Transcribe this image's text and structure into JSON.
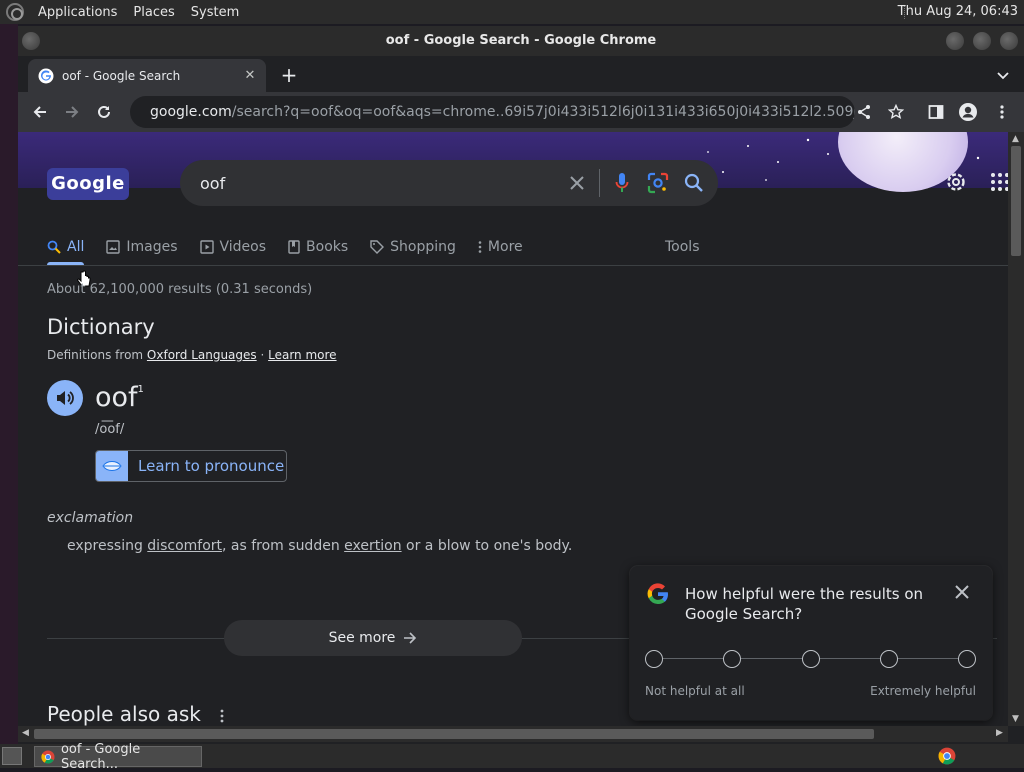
{
  "os": {
    "menus": [
      "Applications",
      "Places",
      "System"
    ],
    "clock": "Thu Aug 24, 06:43"
  },
  "window": {
    "title": "oof - Google Search - Google Chrome"
  },
  "browser": {
    "tab_title": "oof - Google Search",
    "url_host": "google.com",
    "url_rest": "/search?q=oof&oq=oof&aqs=chrome..69i57j0i433i512l6j0i131i433i650j0i433i512l2.509j0j7&sou…"
  },
  "google": {
    "logo_text": "Google",
    "query": "oof",
    "tabs": [
      {
        "label": "All",
        "icon": "search-icon",
        "active": true
      },
      {
        "label": "Images",
        "icon": "image-icon"
      },
      {
        "label": "Videos",
        "icon": "video-icon"
      },
      {
        "label": "Books",
        "icon": "book-icon"
      },
      {
        "label": "Shopping",
        "icon": "tag-icon"
      },
      {
        "label": "More",
        "icon": "more-vert-icon"
      }
    ],
    "tools_label": "Tools",
    "result_stats": "About 62,100,000 results (0.31 seconds)"
  },
  "dictionary": {
    "title": "Dictionary",
    "source_prefix": "Definitions from ",
    "source_link": "Oxford Languages",
    "source_sep": " · ",
    "learn_more": "Learn more",
    "word": "oof",
    "superscript": "1",
    "phonetic": "/o͞of/",
    "learn_pronounce": "Learn to pronounce",
    "part_of_speech": "exclamation",
    "definition_parts": [
      "expressing ",
      "discomfort",
      ", as from sudden ",
      "exertion",
      " or a blow to one's body."
    ],
    "see_more": "See more"
  },
  "people_also_ask": {
    "title": "People also ask"
  },
  "feedback": {
    "question": "How helpful were the results on Google Search?",
    "low_label": "Not helpful at all",
    "high_label": "Extremely helpful",
    "scale_points": 5
  },
  "taskbar": {
    "task_label": "oof - Google Search..."
  },
  "colors": {
    "accent": "#8ab4f8",
    "page_bg": "#202124",
    "text": "#e8eaed",
    "muted": "#9aa0a6"
  }
}
